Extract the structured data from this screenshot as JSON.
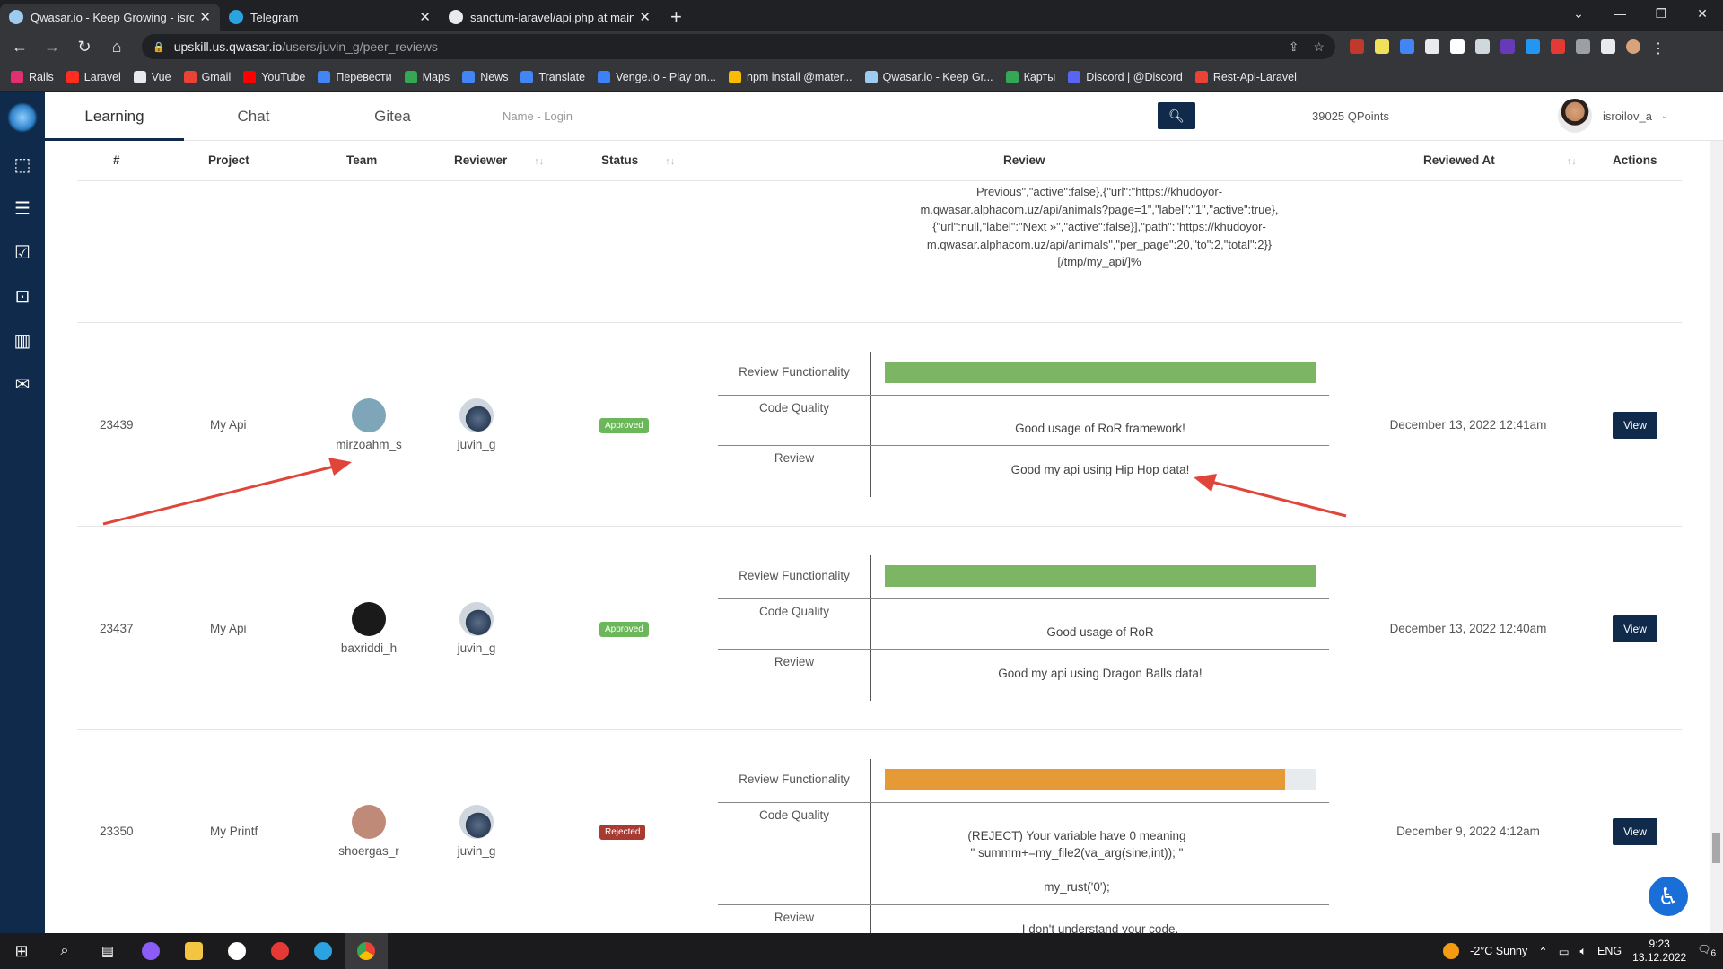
{
  "browser": {
    "tabs": [
      {
        "title": "Qwasar.io - Keep Growing - isroil",
        "fav_color": "#9ecbf0",
        "active": true
      },
      {
        "title": "Telegram",
        "fav_color": "#2aa3e0",
        "active": false
      },
      {
        "title": "sanctum-laravel/api.php at main",
        "fav_color": "#e8eaed",
        "active": false
      }
    ],
    "url_host": "upskill.us.qwasar.io",
    "url_path": "/users/juvin_g/peer_reviews",
    "bookmarks": [
      {
        "label": "Rails",
        "color": "#e1306c"
      },
      {
        "label": "Laravel",
        "color": "#ff2d20"
      },
      {
        "label": "Vue",
        "color": "#e8eaed"
      },
      {
        "label": "Gmail",
        "color": "#ea4335"
      },
      {
        "label": "YouTube",
        "color": "#ff0000"
      },
      {
        "label": "Перевести",
        "color": "#4285f4"
      },
      {
        "label": "Maps",
        "color": "#34a853"
      },
      {
        "label": "News",
        "color": "#4285f4"
      },
      {
        "label": "Translate",
        "color": "#4285f4"
      },
      {
        "label": "Venge.io - Play on...",
        "color": "#3b82f6"
      },
      {
        "label": "npm install @mater...",
        "color": "#fbbc04"
      },
      {
        "label": "Qwasar.io - Keep Gr...",
        "color": "#9ecbf0"
      },
      {
        "label": "Карты",
        "color": "#34a853"
      },
      {
        "label": "Discord | @Discord",
        "color": "#5865f2"
      },
      {
        "label": "Rest-Api-Laravel",
        "color": "#ea4335"
      }
    ]
  },
  "nav": {
    "tabs": [
      "Learning",
      "Chat",
      "Gitea"
    ],
    "search_placeholder": "Name - Login",
    "qpoints": "39025 QPoints",
    "username": "isroilov_a"
  },
  "table": {
    "headers": {
      "num": "#",
      "project": "Project",
      "team": "Team",
      "reviewer": "Reviewer",
      "status": "Status",
      "review": "Review",
      "reviewed_at": "Reviewed At",
      "actions": "Actions"
    },
    "partial_text": [
      "Previous\",\"active\":false},{\"url\":\"https://khudoyor-",
      "m.qwasar.alphacom.uz/api/animals?page=1\",\"label\":\"1\",\"active\":true},",
      "{\"url\":null,\"label\":\"Next »\",\"active\":false}],\"path\":\"https://khudoyor-",
      "m.qwasar.alphacom.uz/api/animals\",\"per_page\":20,\"to\":2,\"total\":2}}",
      "[/tmp/my_api/]%"
    ],
    "labels": {
      "functionality": "Review Functionality",
      "quality": "Code Quality",
      "review": "Review",
      "view": "View"
    },
    "rows": [
      {
        "id": "23439",
        "project": "My Api",
        "team": "mirzoahm_s",
        "reviewer": "juvin_g",
        "status": "Approved",
        "status_color": "#6cb75a",
        "functionality_pct": 100,
        "bar_color": "#7cb564",
        "code_quality": [
          "Good usage of RoR framework!"
        ],
        "review": "Good my api using Hip Hop data!",
        "reviewed_at": "December 13, 2022 12:41am",
        "team_avatar": "#7ea6b8"
      },
      {
        "id": "23437",
        "project": "My Api",
        "team": "baxriddi_h",
        "reviewer": "juvin_g",
        "status": "Approved",
        "status_color": "#6cb75a",
        "functionality_pct": 100,
        "bar_color": "#7cb564",
        "code_quality": [
          "Good usage of RoR"
        ],
        "review": "Good my api using Dragon Balls data!",
        "reviewed_at": "December 13, 2022 12:40am",
        "team_avatar": "#1a1a1a"
      },
      {
        "id": "23350",
        "project": "My Printf",
        "team": "shoergas_r",
        "reviewer": "juvin_g",
        "status": "Rejected",
        "status_color": "#a93a32",
        "functionality_pct": 93,
        "bar_color": "#e69a35",
        "code_quality": [
          "(REJECT) Your variable have 0 meaning",
          "\" summm+=my_file2(va_arg(sine,int)); \"",
          "",
          "my_rust('0');"
        ],
        "review": "I don't understand your code.",
        "reviewed_at": "December 9, 2022 4:12am",
        "team_avatar": "#c08a78"
      }
    ]
  },
  "taskbar": {
    "weather": "-2°C  Sunny",
    "lang": "ENG",
    "time": "9:23",
    "date": "13.12.2022",
    "notifications": "6"
  }
}
